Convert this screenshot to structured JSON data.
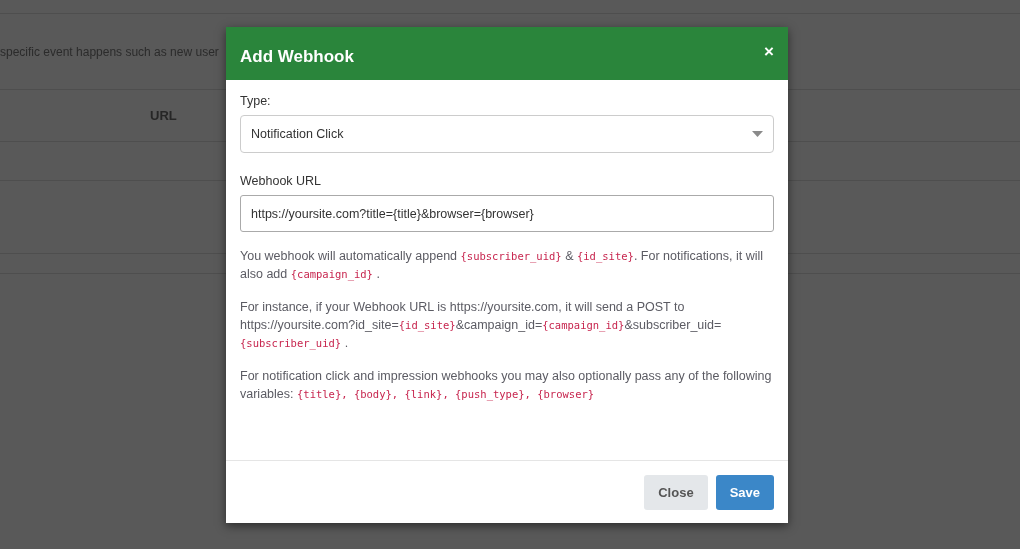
{
  "background_page": {
    "description": "specific event happens such as new user",
    "table": {
      "columns": [
        "URL"
      ]
    }
  },
  "dialog": {
    "title": "Add Webhook",
    "close_icon": "×",
    "type_field": {
      "label": "Type:",
      "value": "Notification Click"
    },
    "url_field": {
      "label": "Webhook URL",
      "value": "https://yoursite.com?title={title}&browser={browser}"
    },
    "paragraphs": [
      [
        {
          "kind": "text",
          "text": "You webhook will automatically append "
        },
        {
          "kind": "code",
          "text": "{subscriber_uid}"
        },
        {
          "kind": "text",
          "text": " & "
        },
        {
          "kind": "code",
          "text": "{id_site}"
        },
        {
          "kind": "text",
          "text": ". For notifications, it will also add "
        },
        {
          "kind": "code",
          "text": "{campaign_id}"
        },
        {
          "kind": "text",
          "text": " ."
        }
      ],
      [
        {
          "kind": "text",
          "text": "For instance, if your Webhook URL is https://yoursite.com, it will send a POST to https://yoursite.com?id_site="
        },
        {
          "kind": "code",
          "text": "{id_site}"
        },
        {
          "kind": "text",
          "text": "&campaign_id="
        },
        {
          "kind": "code",
          "text": "{campaign_id}"
        },
        {
          "kind": "text",
          "text": "&subscriber_uid= "
        },
        {
          "kind": "code",
          "text": "{subscriber_uid}"
        },
        {
          "kind": "text",
          "text": " ."
        }
      ],
      [
        {
          "kind": "text",
          "text": "For notification click and impression webhooks you may also optionally pass any of the following variables: "
        },
        {
          "kind": "code",
          "text": "{title}, {body}, {link}, {push_type}, {browser}"
        }
      ]
    ],
    "buttons": [
      {
        "label": "Close",
        "kind": "secondary"
      },
      {
        "label": "Save",
        "kind": "primary"
      }
    ]
  }
}
